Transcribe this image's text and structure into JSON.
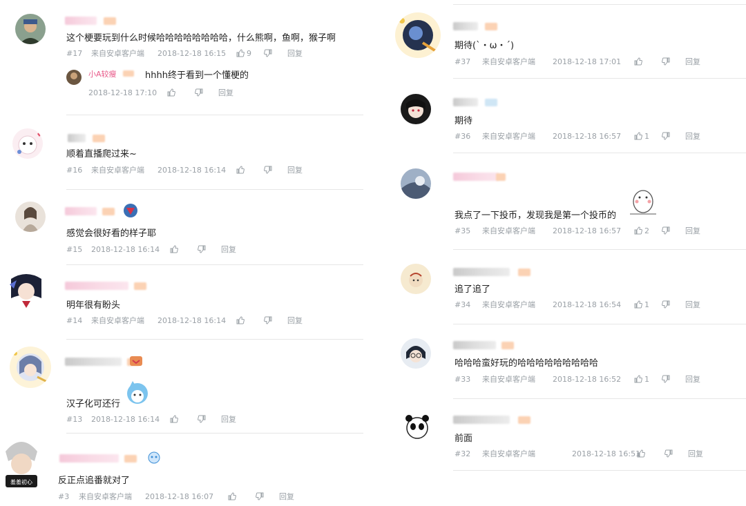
{
  "left": [
    {
      "floor": "#17",
      "device": "来自安卓客户端",
      "time": "2018-12-18 16:15",
      "likes": "9",
      "reply": "回复",
      "text": "这个梗要玩到什么时候哈哈哈哈哈哈哈哈，什么熊啊，鱼啊，猴子啊",
      "sub": {
        "name": "小A较瘦",
        "text": "hhhh终于看到一个懂梗的",
        "time": "2018-12-18 17:10",
        "reply": "回复"
      }
    },
    {
      "floor": "#16",
      "device": "来自安卓客户端",
      "time": "2018-12-18 16:14",
      "likes": "",
      "reply": "回复",
      "text": "顺着直播爬过来~"
    },
    {
      "floor": "#15",
      "device": "",
      "time": "2018-12-18 16:14",
      "likes": "",
      "reply": "回复",
      "text": "感觉会很好看的样子耶"
    },
    {
      "floor": "#14",
      "device": "来自安卓客户端",
      "time": "2018-12-18 16:14",
      "likes": "",
      "reply": "回复",
      "text": "明年很有盼头"
    },
    {
      "floor": "#13",
      "device": "",
      "time": "2018-12-18 16:14",
      "likes": "",
      "reply": "回复",
      "text": "汉子化可还行"
    },
    {
      "floor": "#3",
      "device": "来自安卓客户端",
      "time": "2018-12-18 16:07",
      "likes": "",
      "reply": "回复",
      "text": "反正点追番就对了"
    }
  ],
  "right": [
    {
      "floor": "#37",
      "device": "来自安卓客户端",
      "time": "2018-12-18 17:01",
      "likes": "",
      "reply": "回复",
      "text": "期待(`・ω・´)"
    },
    {
      "floor": "#36",
      "device": "来自安卓客户端",
      "time": "2018-12-18 16:57",
      "likes": "1",
      "reply": "回复",
      "text": "期待"
    },
    {
      "floor": "#35",
      "device": "来自安卓客户端",
      "time": "2018-12-18 16:57",
      "likes": "2",
      "reply": "回复",
      "text": "我点了一下投币，发现我是第一个投币的"
    },
    {
      "floor": "#34",
      "device": "来自安卓客户端",
      "time": "2018-12-18 16:54",
      "likes": "1",
      "reply": "回复",
      "text": "追了追了"
    },
    {
      "floor": "#33",
      "device": "来自安卓客户端",
      "time": "2018-12-18 16:52",
      "likes": "1",
      "reply": "回复",
      "text": "哈哈哈蛮好玩的哈哈哈哈哈哈哈哈哈"
    },
    {
      "floor": "#32",
      "device": "来自安卓客户端",
      "time": "2018-12-18 16:51",
      "likes": "",
      "reply": "回复",
      "text": "前面"
    }
  ],
  "avatar_badge_text": "羞羞初心",
  "colors": {
    "accent": "#e85b8a",
    "meta": "#9aa0a6",
    "divider": "#e6e6e6",
    "name_blur": "#f5c9da"
  }
}
